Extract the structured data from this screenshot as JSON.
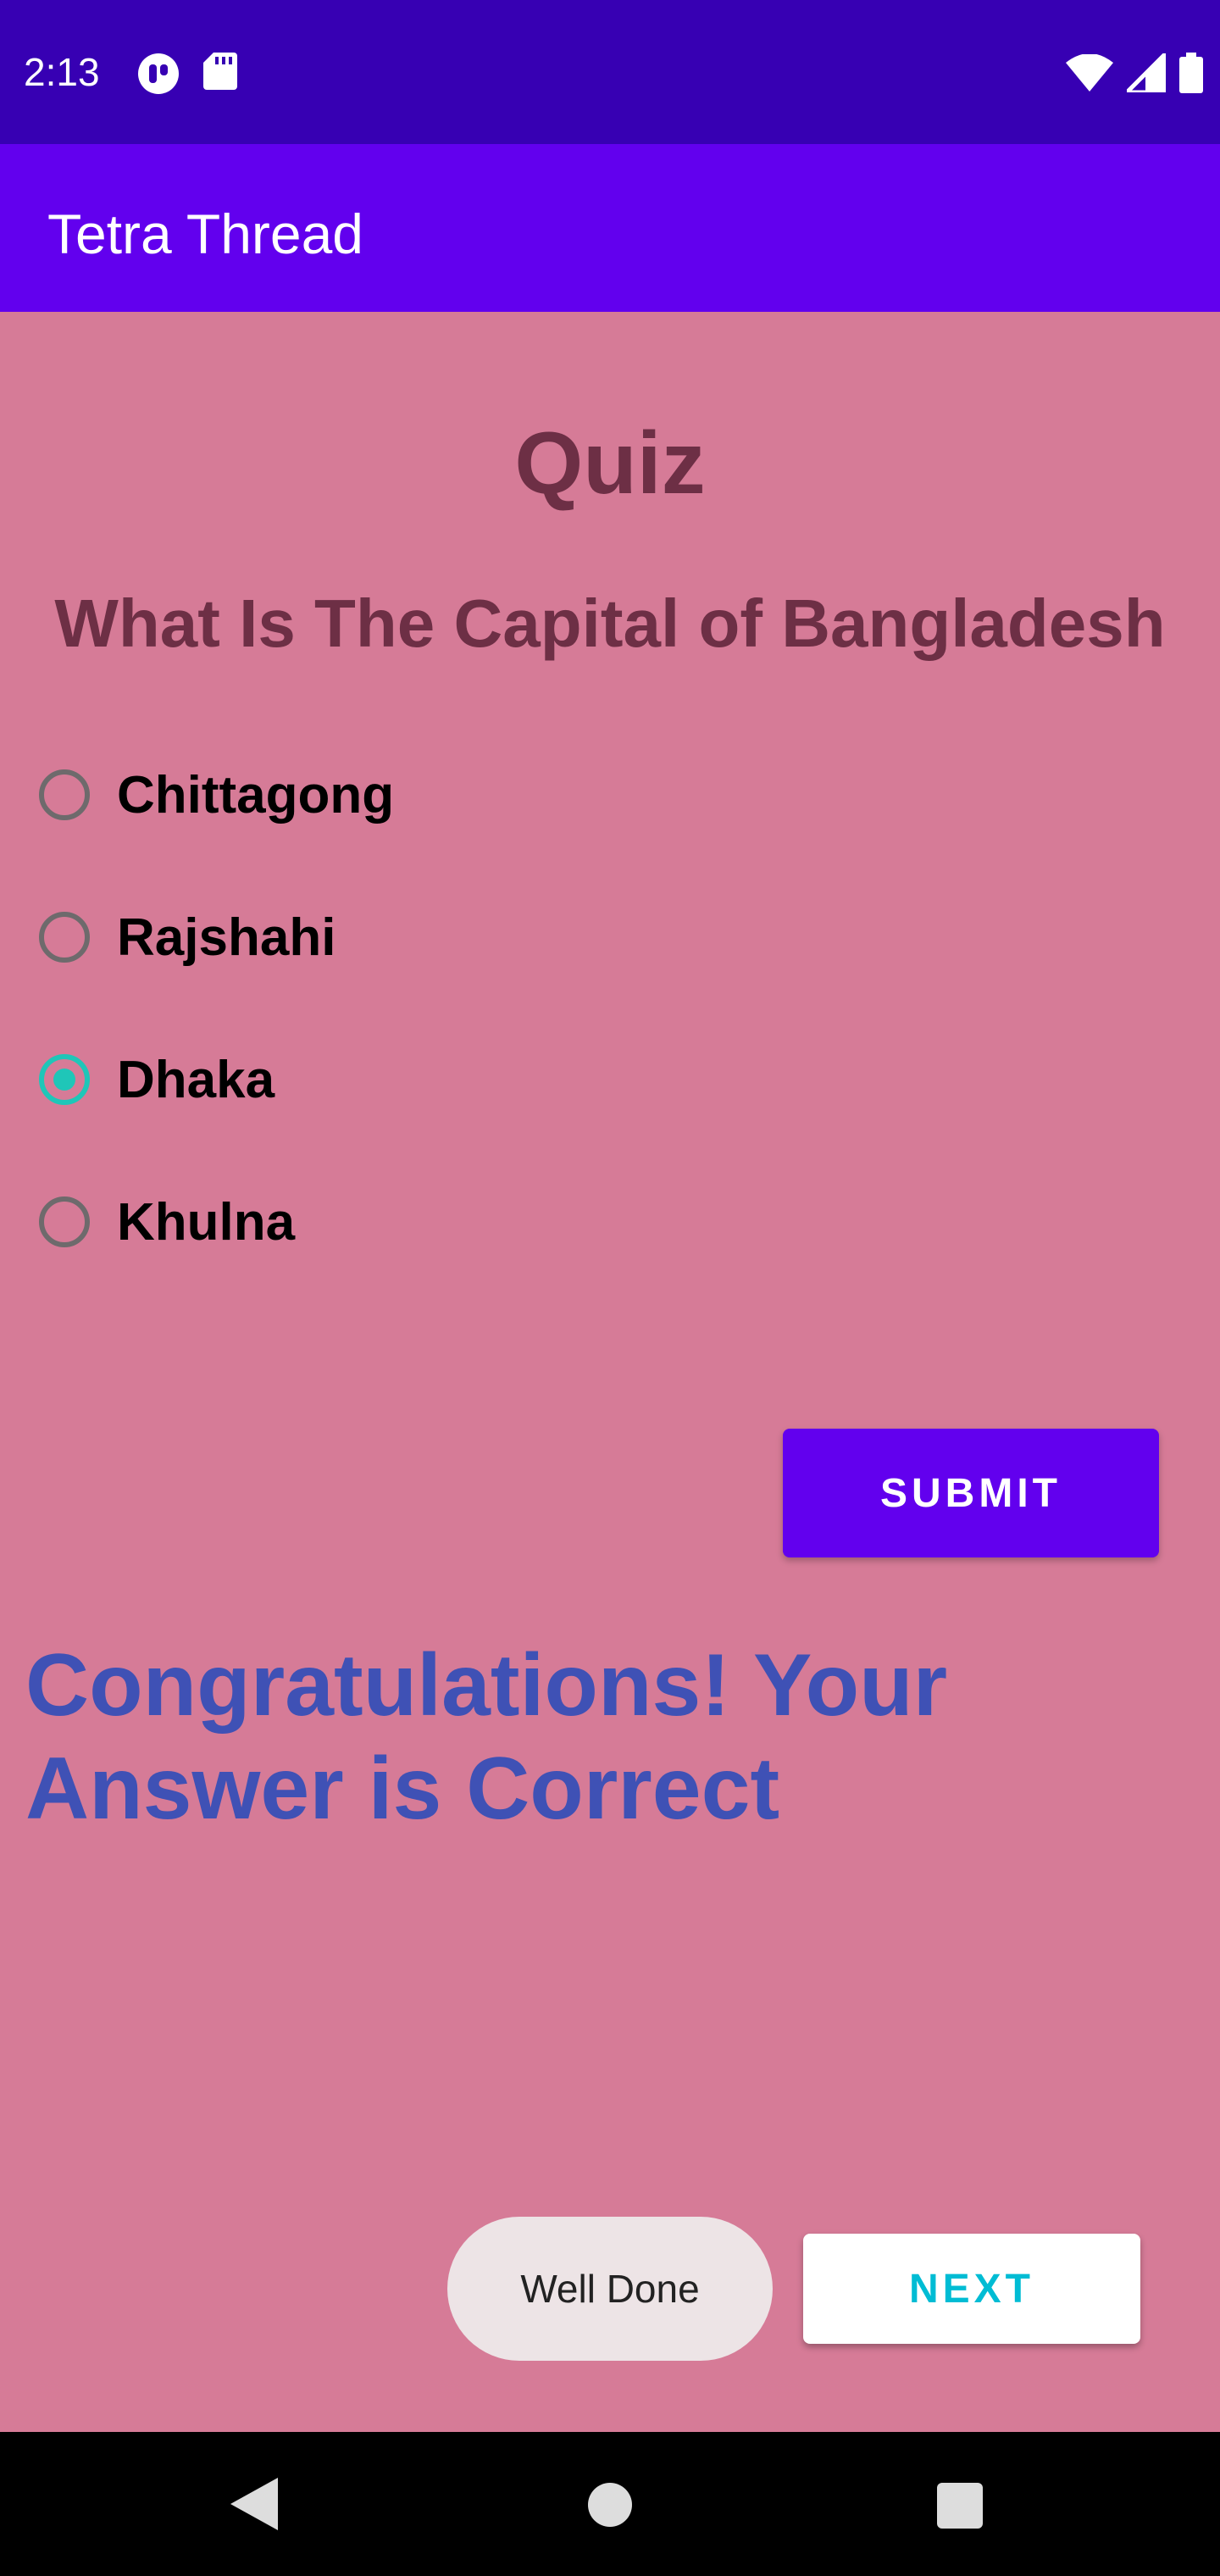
{
  "status_bar": {
    "time": "2:13",
    "left_icons": [
      "vpn-key-icon",
      "sd-card-icon"
    ],
    "right_icons": [
      "wifi-icon",
      "cell-signal-icon",
      "battery-icon"
    ]
  },
  "app_bar": {
    "title": "Tetra Thread"
  },
  "quiz": {
    "title": "Quiz",
    "question": "What Is The Capital of Bangladesh",
    "options": [
      {
        "label": "Chittagong",
        "selected": false
      },
      {
        "label": "Rajshahi",
        "selected": false
      },
      {
        "label": "Dhaka",
        "selected": true
      },
      {
        "label": "Khulna",
        "selected": false
      }
    ],
    "submit_label": "SUBMIT",
    "result_text": "Congratulations! Your Answer is Correct"
  },
  "toast": {
    "text": "Well Done"
  },
  "next_label": "NEXT",
  "nav_bar": {
    "icons": [
      "back-icon",
      "home-icon",
      "recents-icon"
    ]
  },
  "colors": {
    "status_bar": "#3700b3",
    "app_bar": "#6200ee",
    "background": "#d67b97",
    "heading_text": "#6d2f45",
    "radio_selected": "#1fc6b8",
    "result_text": "#3f51b5",
    "next_text": "#00bcd4"
  }
}
